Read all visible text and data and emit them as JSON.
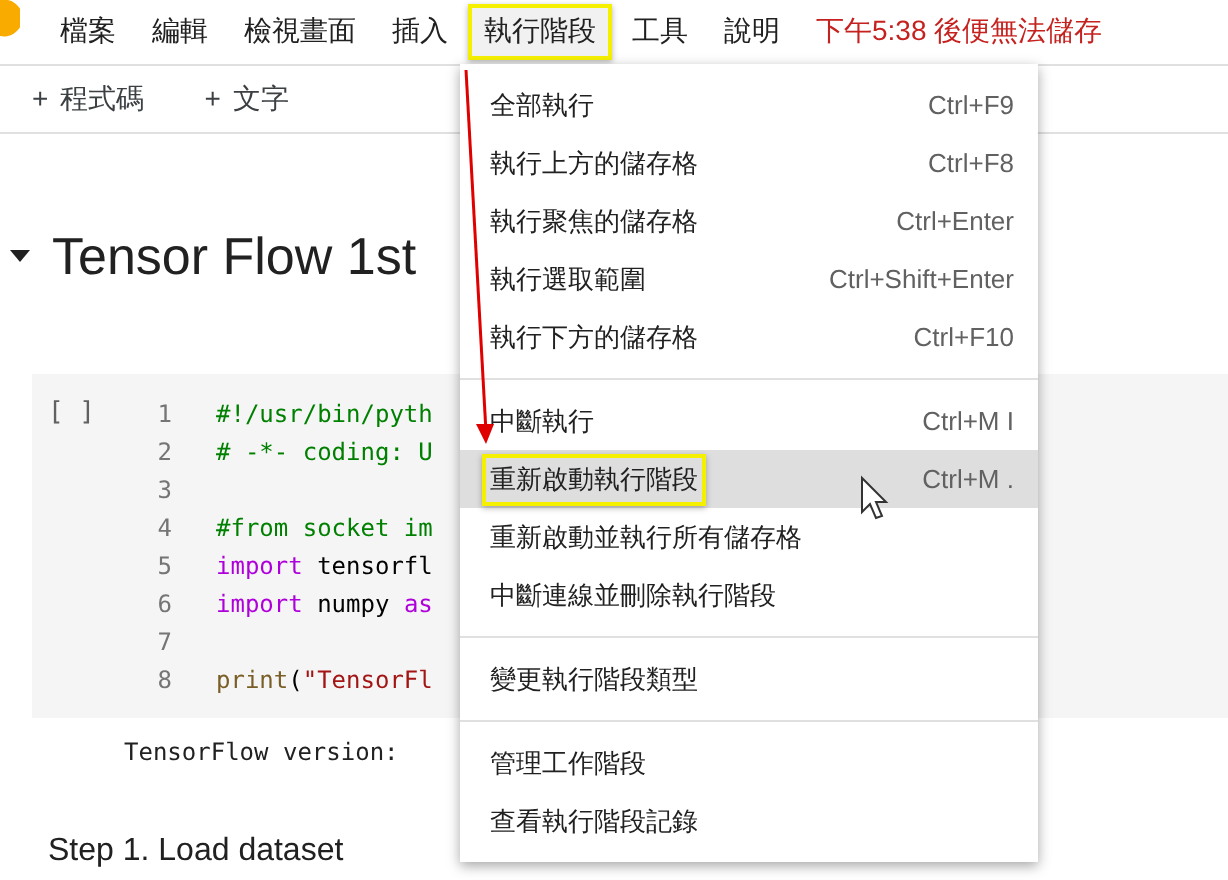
{
  "menu_bar": [
    {
      "label": "檔案",
      "selected": false
    },
    {
      "label": "編輯",
      "selected": false
    },
    {
      "label": "檢視畫面",
      "selected": false
    },
    {
      "label": "插入",
      "selected": false
    },
    {
      "label": "執行階段",
      "selected": true
    },
    {
      "label": "工具",
      "selected": false
    },
    {
      "label": "說明",
      "selected": false
    }
  ],
  "save_warning": "下午5:38 後便無法儲存",
  "toolbar": [
    {
      "icon": "+",
      "label": "程式碼"
    },
    {
      "icon": "+",
      "label": "文字"
    }
  ],
  "heading": "Tensor Flow 1st",
  "code_cell": {
    "run_label": "[ ]",
    "lines": [
      {
        "number": "1",
        "tokens": [
          {
            "kind": "comment",
            "text": "#!/usr/bin/pyth"
          }
        ]
      },
      {
        "number": "2",
        "tokens": [
          {
            "kind": "comment",
            "text": "# -*- coding: U"
          }
        ]
      },
      {
        "number": "3"
      },
      {
        "number": "4",
        "tokens": [
          {
            "kind": "comment",
            "text": "#from socket im"
          }
        ]
      },
      {
        "number": "5",
        "tokens": [
          {
            "kind": "keyword",
            "text": "import"
          },
          {
            "kind": "plain",
            "text": " tensorfl"
          }
        ]
      },
      {
        "number": "6",
        "tokens": [
          {
            "kind": "keyword",
            "text": "import"
          },
          {
            "kind": "plain",
            "text": " numpy "
          },
          {
            "kind": "keyword",
            "text": "as"
          }
        ]
      },
      {
        "number": "7"
      },
      {
        "number": "8",
        "tokens": [
          {
            "kind": "function",
            "text": "print"
          },
          {
            "kind": "plain",
            "text": "("
          },
          {
            "kind": "string",
            "text": "\"TensorFl"
          }
        ]
      }
    ]
  },
  "output": "TensorFlow version:",
  "step_heading": "Step 1. Load dataset",
  "dropdown_menu": {
    "groups": [
      [
        {
          "label": "全部執行",
          "shortcut": "Ctrl+F9",
          "hovered": false
        },
        {
          "label": "執行上方的儲存格",
          "shortcut": "Ctrl+F8",
          "hovered": false
        },
        {
          "label": "執行聚焦的儲存格",
          "shortcut": "Ctrl+Enter",
          "hovered": false
        },
        {
          "label": "執行選取範圍",
          "shortcut": "Ctrl+Shift+Enter",
          "hovered": false
        },
        {
          "label": "執行下方的儲存格",
          "shortcut": "Ctrl+F10",
          "hovered": false
        }
      ],
      [
        {
          "label": "中斷執行",
          "shortcut": "Ctrl+M I",
          "hovered": false
        },
        {
          "label": "重新啟動執行階段",
          "shortcut": "Ctrl+M .",
          "hovered": true
        },
        {
          "label": "重新啟動並執行所有儲存格",
          "hovered": false
        },
        {
          "label": "中斷連線並刪除執行階段",
          "hovered": false
        }
      ],
      [
        {
          "label": "變更執行階段類型",
          "hovered": false
        }
      ],
      [
        {
          "label": "管理工作階段",
          "hovered": false
        },
        {
          "label": "查看執行階段記錄",
          "hovered": false
        }
      ]
    ]
  }
}
